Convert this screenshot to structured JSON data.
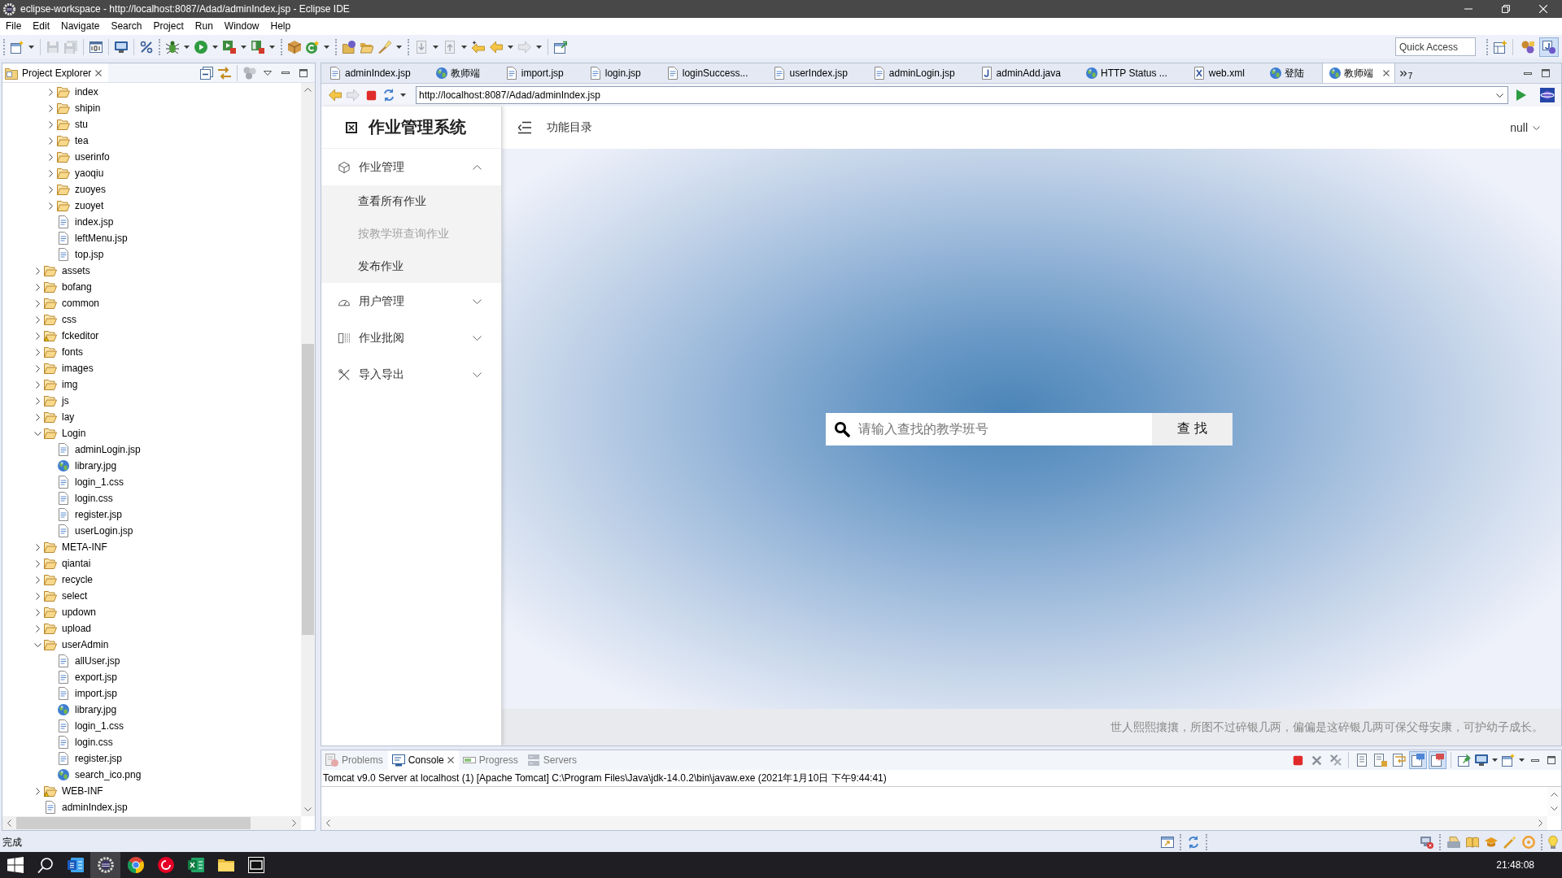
{
  "window": {
    "title": "eclipse-workspace - http://localhost:8087/Adad/adminIndex.jsp - Eclipse IDE"
  },
  "menu_bar": [
    {
      "label": "File"
    },
    {
      "label": "Edit"
    },
    {
      "label": "Navigate"
    },
    {
      "label": "Search"
    },
    {
      "label": "Project"
    },
    {
      "label": "Run"
    },
    {
      "label": "Window"
    },
    {
      "label": "Help"
    }
  ],
  "toolbar": {
    "quick_access": {
      "placeholder": "Quick Access"
    },
    "perspectives": [
      {
        "selected": false
      },
      {
        "selected": true
      }
    ]
  },
  "project_explorer": {
    "title": "Project Explorer",
    "tree": {
      "continued": [
        {
          "label": "index",
          "kind": "folder",
          "expanded": false,
          "warning": false
        },
        {
          "label": "shipin",
          "kind": "folder",
          "expanded": false,
          "warning": false
        },
        {
          "label": "stu",
          "kind": "folder",
          "expanded": false,
          "warning": false
        },
        {
          "label": "tea",
          "kind": "folder",
          "expanded": false,
          "warning": false
        },
        {
          "label": "userinfo",
          "kind": "folder",
          "expanded": false,
          "warning": false
        },
        {
          "label": "yaoqiu",
          "kind": "folder",
          "expanded": false,
          "warning": false
        },
        {
          "label": "zuoyes",
          "kind": "folder",
          "expanded": false,
          "warning": false
        },
        {
          "label": "zuoyet",
          "kind": "folder",
          "expanded": false,
          "warning": false
        },
        {
          "label": "index.jsp",
          "kind": "file",
          "warning": false
        },
        {
          "label": "leftMenu.jsp",
          "kind": "file",
          "warning": false
        },
        {
          "label": "top.jsp",
          "kind": "file",
          "warning": false
        }
      ],
      "items": [
        {
          "label": "assets",
          "kind": "folder",
          "expanded": false,
          "warning": false
        },
        {
          "label": "bofang",
          "kind": "folder",
          "expanded": false,
          "warning": false
        },
        {
          "label": "common",
          "kind": "folder",
          "expanded": false,
          "warning": false
        },
        {
          "label": "css",
          "kind": "folder",
          "expanded": false,
          "warning": false
        },
        {
          "label": "fckeditor",
          "kind": "folder",
          "expanded": false,
          "warning": true
        },
        {
          "label": "fonts",
          "kind": "folder",
          "expanded": false,
          "warning": false
        },
        {
          "label": "images",
          "kind": "folder",
          "expanded": false,
          "warning": false
        },
        {
          "label": "img",
          "kind": "folder",
          "expanded": false,
          "warning": false
        },
        {
          "label": "js",
          "kind": "folder",
          "expanded": false,
          "warning": false
        },
        {
          "label": "lay",
          "kind": "folder",
          "expanded": false,
          "warning": false
        },
        {
          "label": "Login",
          "kind": "folder",
          "expanded": true,
          "warning": false,
          "children": [
            {
              "label": "adminLogin.jsp",
              "kind": "file",
              "warning": false
            },
            {
              "label": "library.jpg",
              "kind": "image",
              "warning": false
            },
            {
              "label": "login_1.css",
              "kind": "file",
              "warning": false
            },
            {
              "label": "login.css",
              "kind": "file",
              "warning": false
            },
            {
              "label": "register.jsp",
              "kind": "file",
              "warning": false
            },
            {
              "label": "userLogin.jsp",
              "kind": "file",
              "warning": false
            }
          ]
        },
        {
          "label": "META-INF",
          "kind": "folder",
          "expanded": false,
          "warning": false
        },
        {
          "label": "qiantai",
          "kind": "folder",
          "expanded": false,
          "warning": false
        },
        {
          "label": "recycle",
          "kind": "folder",
          "expanded": false,
          "warning": false
        },
        {
          "label": "select",
          "kind": "folder",
          "expanded": false,
          "warning": false
        },
        {
          "label": "updown",
          "kind": "folder",
          "expanded": false,
          "warning": false
        },
        {
          "label": "upload",
          "kind": "folder",
          "expanded": false,
          "warning": false
        },
        {
          "label": "userAdmin",
          "kind": "folder",
          "expanded": true,
          "warning": false,
          "children": [
            {
              "label": "allUser.jsp",
              "kind": "file",
              "warning": false
            },
            {
              "label": "export.jsp",
              "kind": "file",
              "warning": false
            },
            {
              "label": "import.jsp",
              "kind": "file",
              "warning": false
            },
            {
              "label": "library.jpg",
              "kind": "image",
              "warning": false
            },
            {
              "label": "login_1.css",
              "kind": "file",
              "warning": false
            },
            {
              "label": "login.css",
              "kind": "file",
              "warning": false
            },
            {
              "label": "register.jsp",
              "kind": "file",
              "warning": false
            },
            {
              "label": "search_ico.png",
              "kind": "image",
              "warning": false
            }
          ]
        },
        {
          "label": "WEB-INF",
          "kind": "folder",
          "expanded": false,
          "warning": true
        },
        {
          "label": "adminIndex.jsp",
          "kind": "file",
          "warning": false
        }
      ]
    }
  },
  "editor": {
    "tabs": [
      {
        "label": "adminIndex.jsp",
        "kind": "file",
        "selected": false
      },
      {
        "label": "教师端",
        "kind": "web",
        "selected": false
      },
      {
        "label": "import.jsp",
        "kind": "file",
        "selected": false
      },
      {
        "label": "login.jsp",
        "kind": "file",
        "selected": false
      },
      {
        "label": "loginSuccess...",
        "kind": "file",
        "selected": false
      },
      {
        "label": "userIndex.jsp",
        "kind": "file",
        "selected": false
      },
      {
        "label": "adminLogin.jsp",
        "kind": "file",
        "selected": false
      },
      {
        "label": "adminAdd.java",
        "kind": "java",
        "selected": false
      },
      {
        "label": "HTTP Status ...",
        "kind": "web",
        "selected": false
      },
      {
        "label": "web.xml",
        "kind": "xml",
        "selected": false
      },
      {
        "label": "登陆",
        "kind": "web",
        "selected": false
      },
      {
        "label": "教师端",
        "kind": "web",
        "selected": true
      }
    ],
    "hidden_count": "7"
  },
  "browser": {
    "url": "http://localhost:8087/Adad/adminIndex.jsp"
  },
  "web_page": {
    "sidebar": {
      "title": "作业管理系统",
      "groups": [
        {
          "label": "作业管理",
          "expanded": true,
          "items": [
            {
              "label": "查看所有作业",
              "selected": false
            },
            {
              "label": "按教学班查询作业",
              "selected": true
            },
            {
              "label": "发布作业",
              "selected": false
            }
          ]
        },
        {
          "label": "用户管理",
          "expanded": false
        },
        {
          "label": "作业批阅",
          "expanded": false
        },
        {
          "label": "导入导出",
          "expanded": false
        }
      ]
    },
    "header": {
      "menu_label": "功能目录",
      "user": "null"
    },
    "search": {
      "placeholder": "请输入查找的教学班号",
      "button": "查 找"
    },
    "footer": "世人熙熙攘攘，所图不过碎银几两，偏偏是这碎银几两可保父母安康，可护幼子成长。"
  },
  "console": {
    "tabs": [
      {
        "label": "Problems",
        "selected": false
      },
      {
        "label": "Console",
        "selected": true
      },
      {
        "label": "Progress",
        "selected": false
      },
      {
        "label": "Servers",
        "selected": false
      }
    ],
    "toggles": [
      {
        "on": true
      },
      {
        "on": true
      }
    ],
    "process": "Tomcat v9.0 Server at localhost (1) [Apache Tomcat] C:\\Program Files\\Java\\jdk-14.0.2\\bin\\javaw.exe (2021年1月10日 下午9:44:41)"
  },
  "status_bar": {
    "message": "完成"
  },
  "taskbar": {
    "apps": [
      {
        "selected": false
      },
      {
        "selected": true
      },
      {
        "selected": false
      },
      {
        "selected": false
      },
      {
        "selected": false
      },
      {
        "selected": false
      },
      {
        "selected": false
      }
    ],
    "clock": "21:48:08"
  }
}
